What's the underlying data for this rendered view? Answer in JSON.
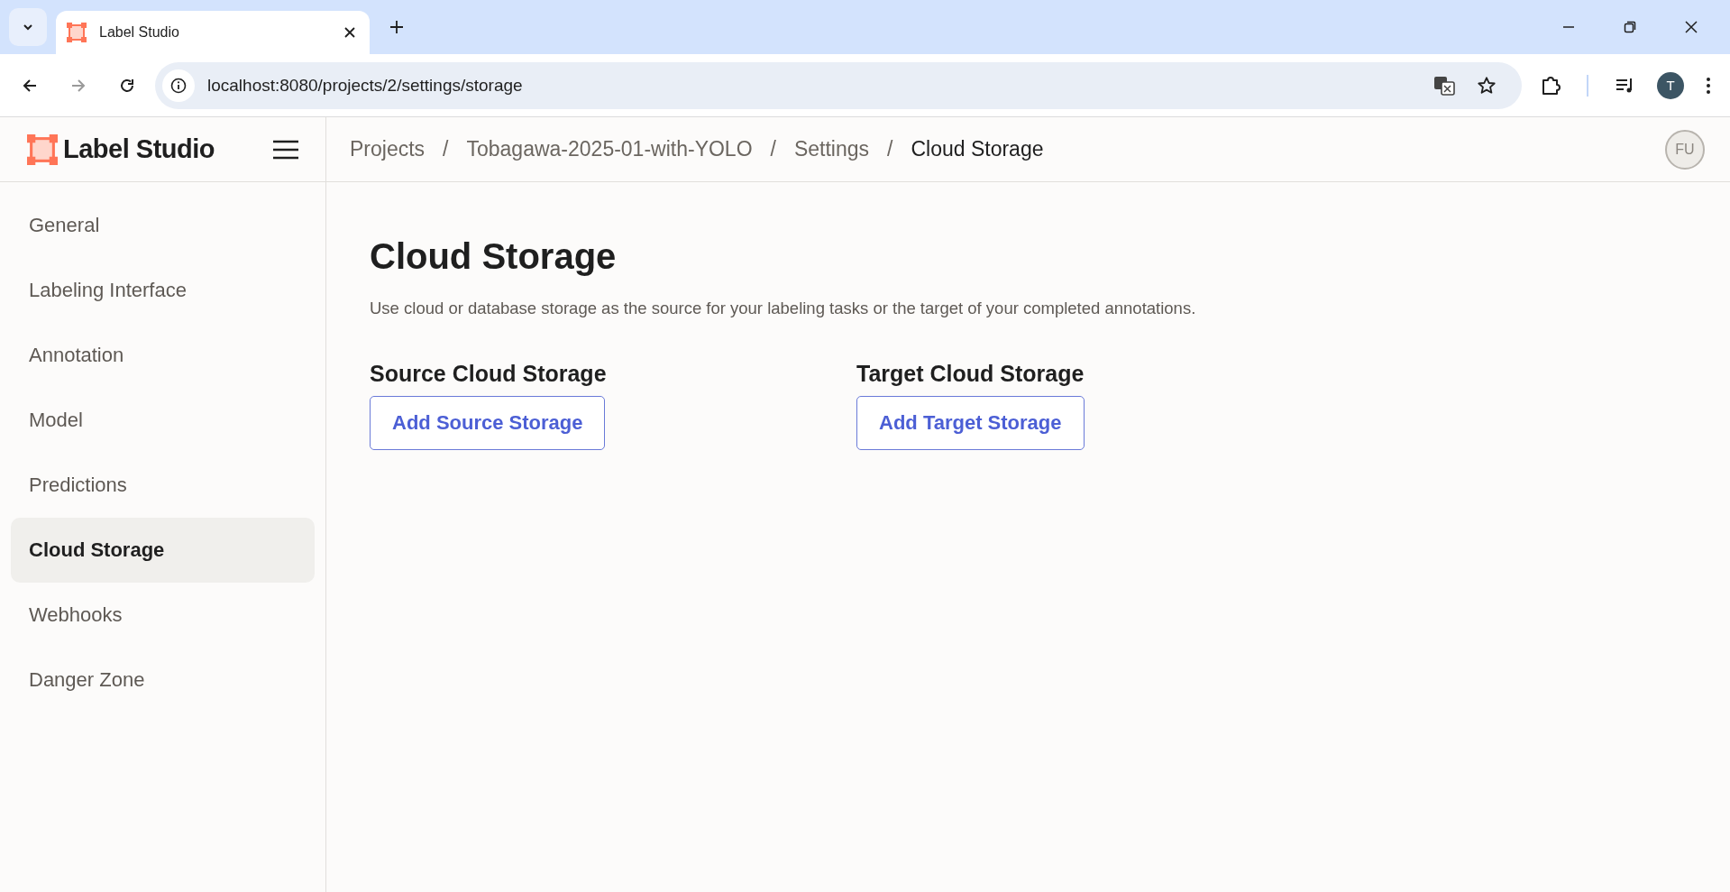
{
  "browser": {
    "tabs": [
      {
        "title": "Label Studio",
        "selected": true
      }
    ],
    "url": "localhost:8080/projects/2/settings/storage",
    "profile_initial": "T"
  },
  "app": {
    "logo_text": "Label Studio",
    "breadcrumbs": [
      {
        "label": "Projects",
        "current": false
      },
      {
        "label": "Tobagawa-2025-01-with-YOLO",
        "current": false
      },
      {
        "label": "Settings",
        "current": false
      },
      {
        "label": "Cloud Storage",
        "current": true
      }
    ],
    "separator": "/",
    "user_initials": "FU"
  },
  "sidebar": {
    "items": [
      {
        "label": "General",
        "selected": false
      },
      {
        "label": "Labeling Interface",
        "selected": false
      },
      {
        "label": "Annotation",
        "selected": false
      },
      {
        "label": "Model",
        "selected": false
      },
      {
        "label": "Predictions",
        "selected": false
      },
      {
        "label": "Cloud Storage",
        "selected": true
      },
      {
        "label": "Webhooks",
        "selected": false
      },
      {
        "label": "Danger Zone",
        "selected": false
      }
    ]
  },
  "content": {
    "title": "Cloud Storage",
    "description": "Use cloud or database storage as the source for your labeling tasks or the target of your completed annotations.",
    "sections": [
      {
        "heading": "Source Cloud Storage",
        "button": "Add Source Storage"
      },
      {
        "heading": "Target Cloud Storage",
        "button": "Add Target Storage"
      }
    ]
  }
}
